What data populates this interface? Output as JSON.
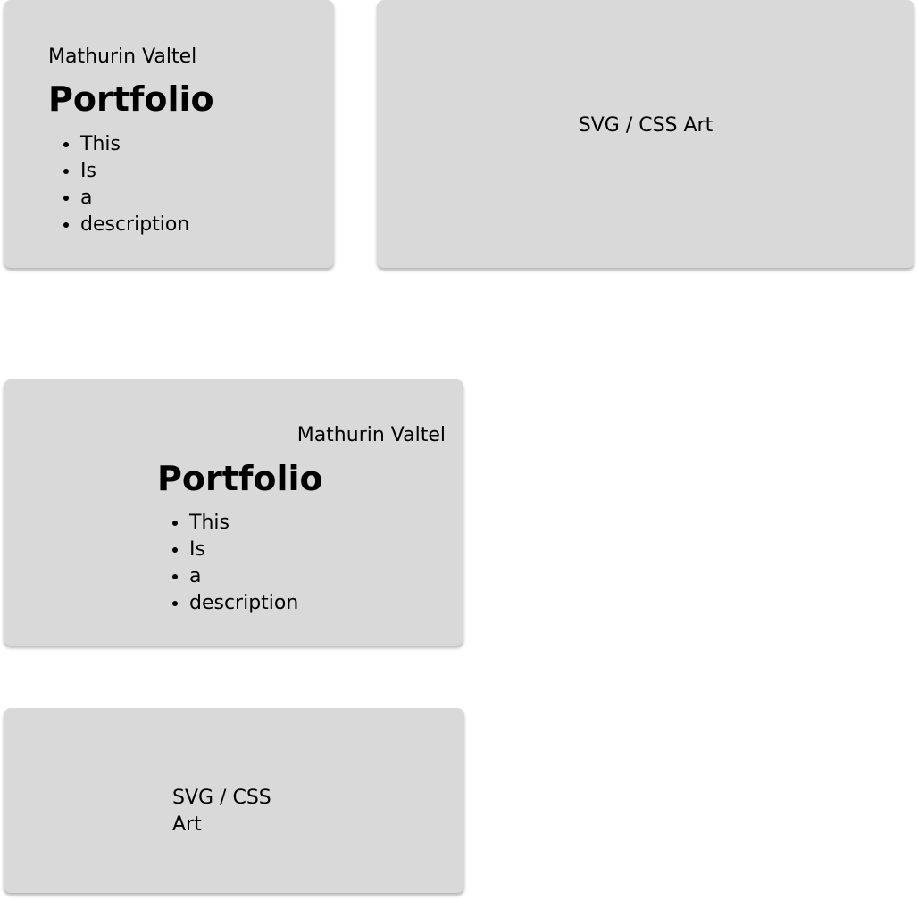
{
  "intro_card": {
    "author": "Mathurin Valtel",
    "title": "Portfolio",
    "description": [
      "This",
      "Is",
      "a",
      "description"
    ]
  },
  "art_card": {
    "label": "SVG / CSS Art"
  },
  "intro_card_variant": {
    "author": "Mathurin Valtel",
    "title": "Portfolio",
    "description": [
      "This",
      "Is",
      "a",
      "description"
    ]
  },
  "art_card_variant": {
    "label": "SVG / CSS Art"
  },
  "colors": {
    "card_background": "#d9d9d9",
    "page_background": "#ffffff",
    "text": "#000000"
  }
}
